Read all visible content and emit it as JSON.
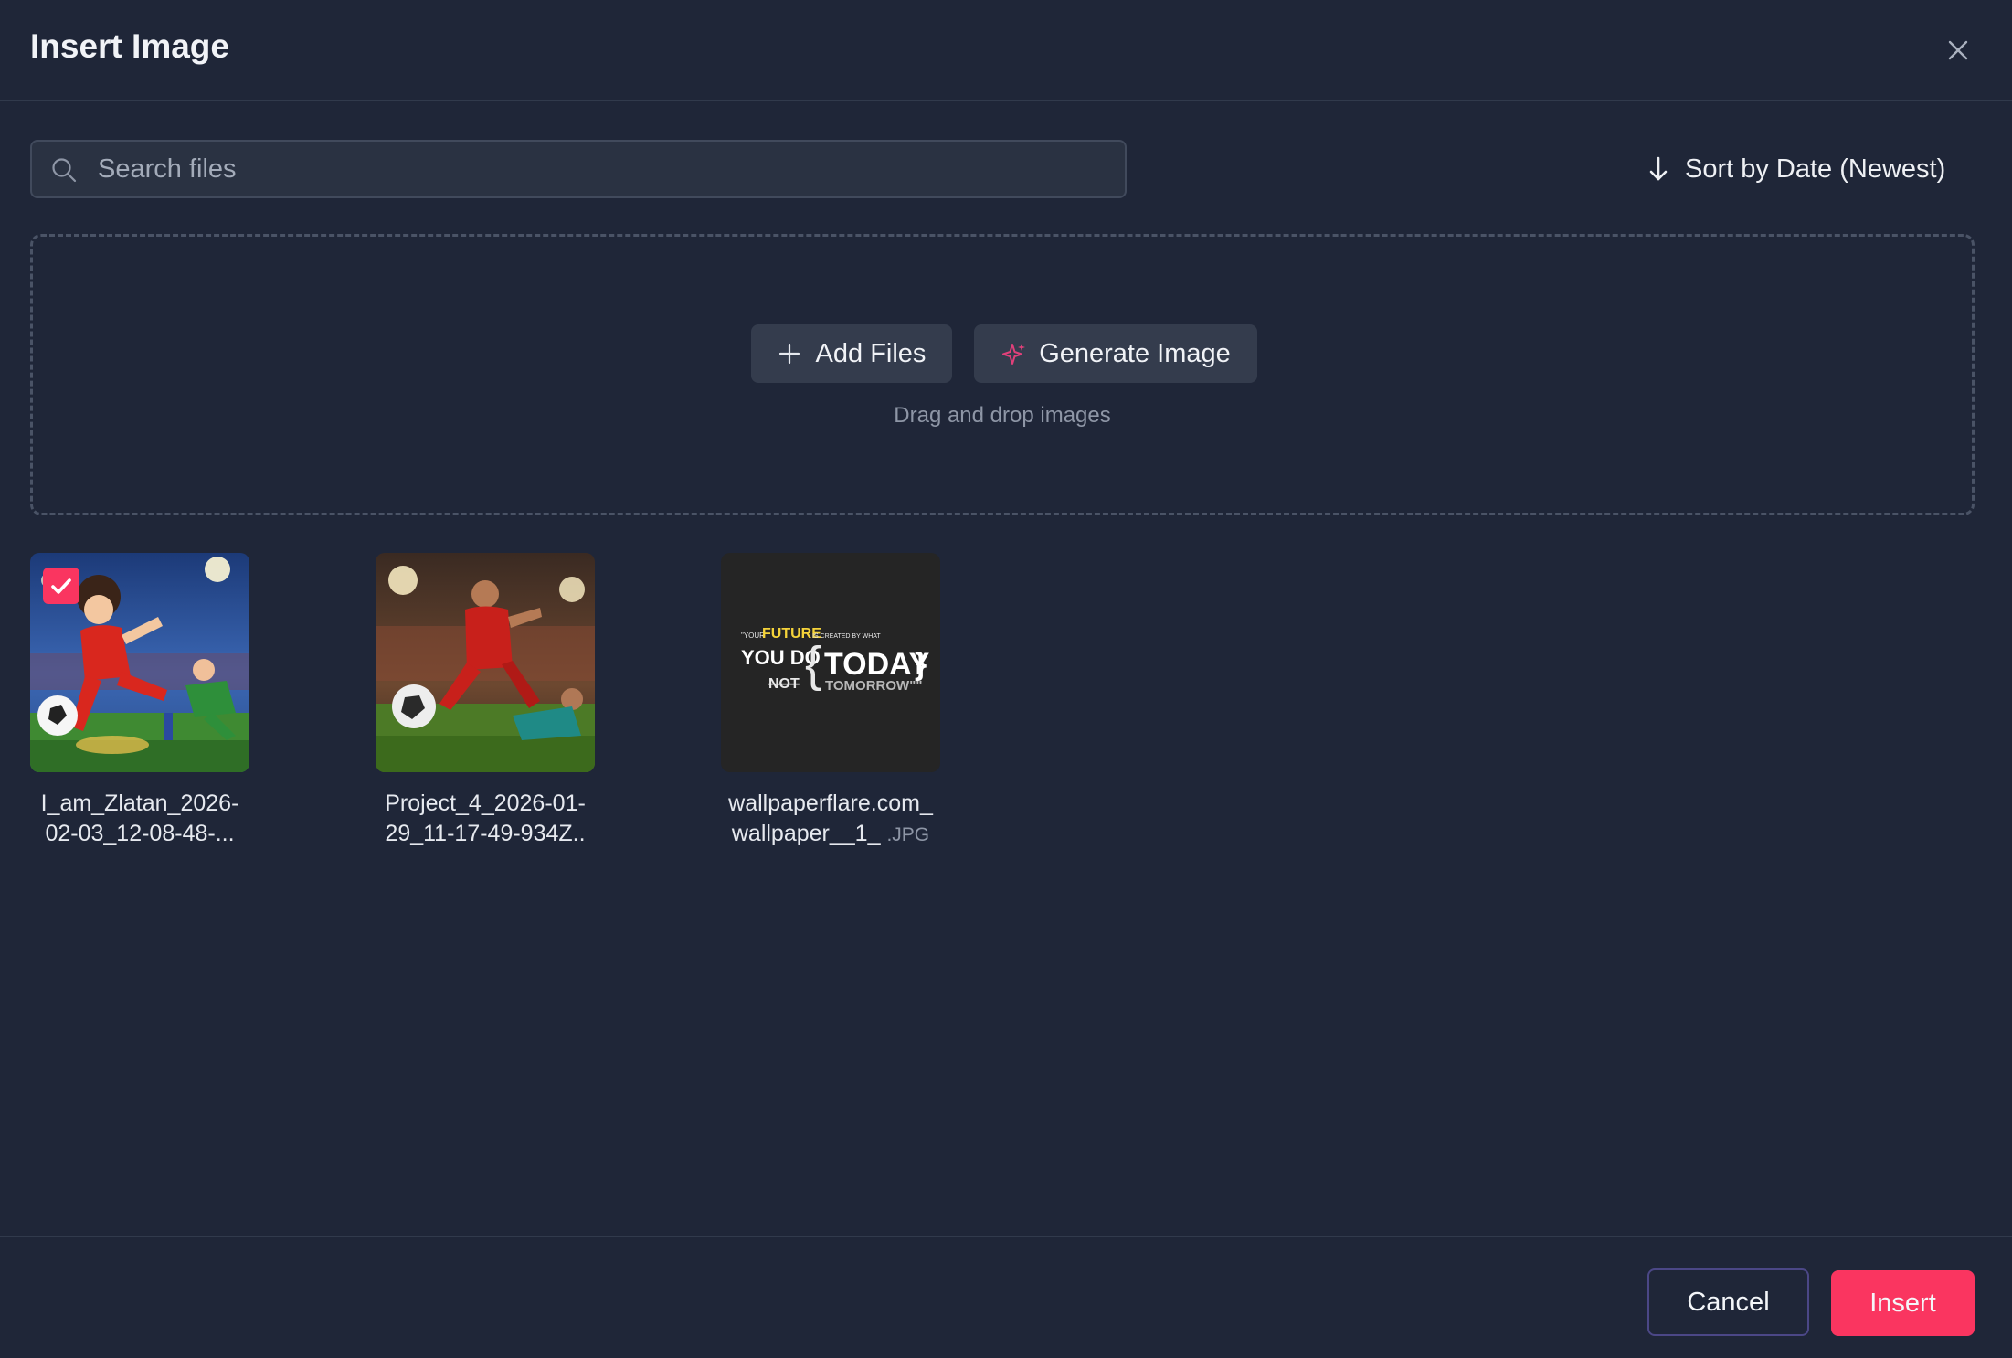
{
  "dialog": {
    "title": "Insert Image",
    "close_icon": "close-icon"
  },
  "search": {
    "placeholder": "Search files",
    "value": "",
    "icon": "search-icon"
  },
  "sort": {
    "label": "Sort by Date (Newest)",
    "icon": "arrow-down-icon"
  },
  "dropzone": {
    "add_files_label": "Add Files",
    "add_files_icon": "plus-icon",
    "generate_label": "Generate Image",
    "generate_icon": "sparkle-icon",
    "hint": "Drag and drop images"
  },
  "files": [
    {
      "name_line1": "I_am_Zlatan_2026-",
      "name_line2": "02-03_12-08-48-...",
      "selected": true,
      "thumbnail": "anime-soccer-kick"
    },
    {
      "name_line1": "Project_4_2026-01-",
      "name_line2": "29_11-17-49-934Z..",
      "selected": false,
      "thumbnail": "soccer-stadium-kick"
    },
    {
      "name_line1": "wallpaperflare.com_",
      "name_line2": "wallpaper__1_",
      "extension": ".JPG",
      "selected": false,
      "thumbnail": "quote-wallpaper",
      "quote": {
        "pre": "\"YOUR",
        "future": "FUTURE",
        "created": "IS CREATED BY WHAT",
        "you_do": "YOU DO",
        "not": "NOT",
        "today": "TODAY",
        "tomorrow": "TOMORROW\"\""
      }
    }
  ],
  "footer": {
    "cancel_label": "Cancel",
    "insert_label": "Insert"
  },
  "colors": {
    "background": "#1f2638",
    "accent": "#fa3560",
    "sparkle": "#e0407a",
    "quote_highlight": "#f5d33a"
  }
}
